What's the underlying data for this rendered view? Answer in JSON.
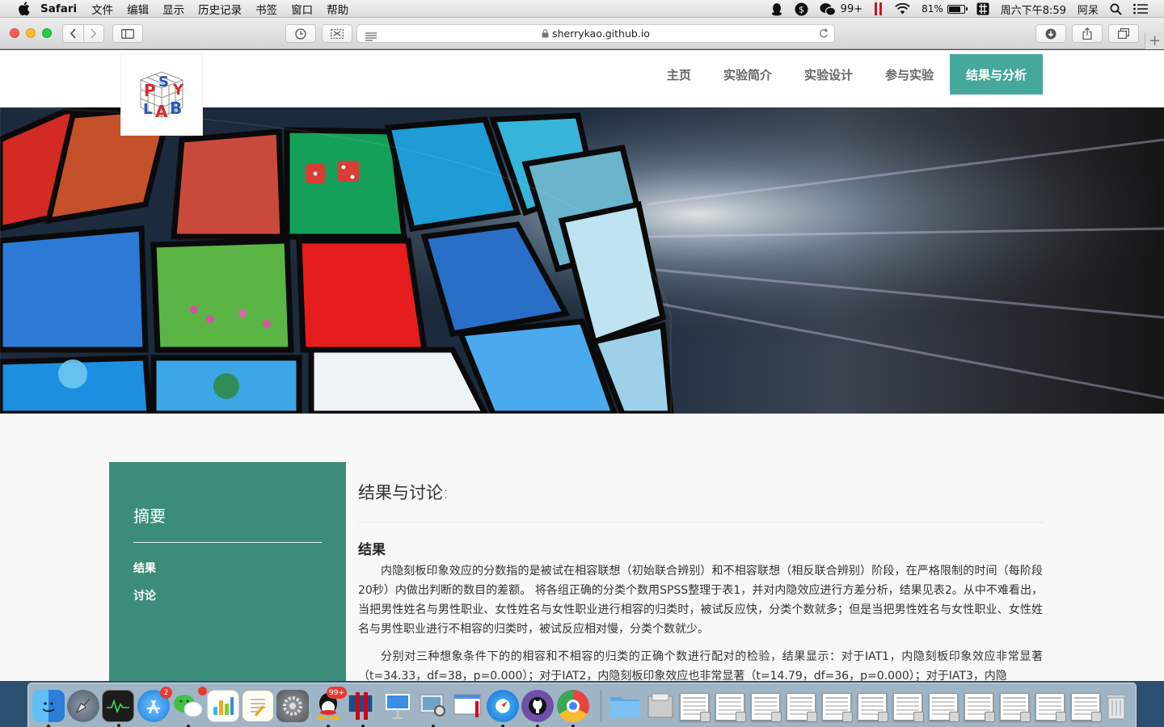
{
  "menubar": {
    "app_name": "Safari",
    "items": [
      "文件",
      "编辑",
      "显示",
      "历史记录",
      "书签",
      "窗口",
      "帮助"
    ],
    "wechat_count": "99+",
    "battery_percent": "81%",
    "battery_level": 0.81,
    "datetime": "周六下午8:59",
    "user": "阿呆"
  },
  "browser": {
    "url": "sherrykao.github.io"
  },
  "site": {
    "logo_letters": [
      "P",
      "S",
      "L",
      "A",
      "B",
      "Y"
    ],
    "nav": [
      {
        "label": "主页",
        "active": false
      },
      {
        "label": "实验简介",
        "active": false
      },
      {
        "label": "实验设计",
        "active": false
      },
      {
        "label": "参与实验",
        "active": false
      },
      {
        "label": "结果与分析",
        "active": true
      }
    ],
    "accent_color": "#45a89a",
    "sidebar_color": "#3b8c7a"
  },
  "sidebar": {
    "title": "摘要",
    "links": [
      "结果",
      "讨论"
    ]
  },
  "content": {
    "heading": "结果与讨论:",
    "subheading": "结果",
    "paragraphs": [
      "内隐刻板印象效应的分数指的是被试在相容联想（初始联合辨别）和不相容联想（相反联合辨别）阶段，在严格限制的时间（每阶段20秒）内做出判断的数目的差额。 将各组正确的分类个数用SPSS整理于表1，并对内隐效应进行方差分析，结果见表2。从中不难看出，当把男性姓名与男性职业、女性姓名与女性职业进行相容的归类时，被试反应快，分类个数就多；但是当把男性姓名与女性职业、女性姓名与男性职业进行不相容的归类时，被试反应相对慢，分类个数就少。",
      "分别对三种想象条件下的的相容和不相容的归类的正确个数进行配对的检验，结果显示：对于IAT1，内隐刻板印象效应非常显著（t=34.33，df=38，p=0.000）；对于IAT2，内隐刻板印象效应也非常显著（t=14.79，df=36，p=0.000）；对于IAT3，内隐"
    ]
  },
  "dock": {
    "app_store_badge": "2",
    "qq_badge": "99+",
    "apps": [
      "finder-icon",
      "launchpad-icon",
      "activity-monitor-icon",
      "app-store-icon",
      "wechat-icon",
      "numbers-icon",
      "textedit-icon",
      "system-preferences-icon",
      "qq-icon",
      "parallels-icon",
      "keynote-icon",
      "preview-icon",
      "screenshot-icon",
      "safari-icon",
      "github-icon",
      "chrome-icon"
    ]
  }
}
